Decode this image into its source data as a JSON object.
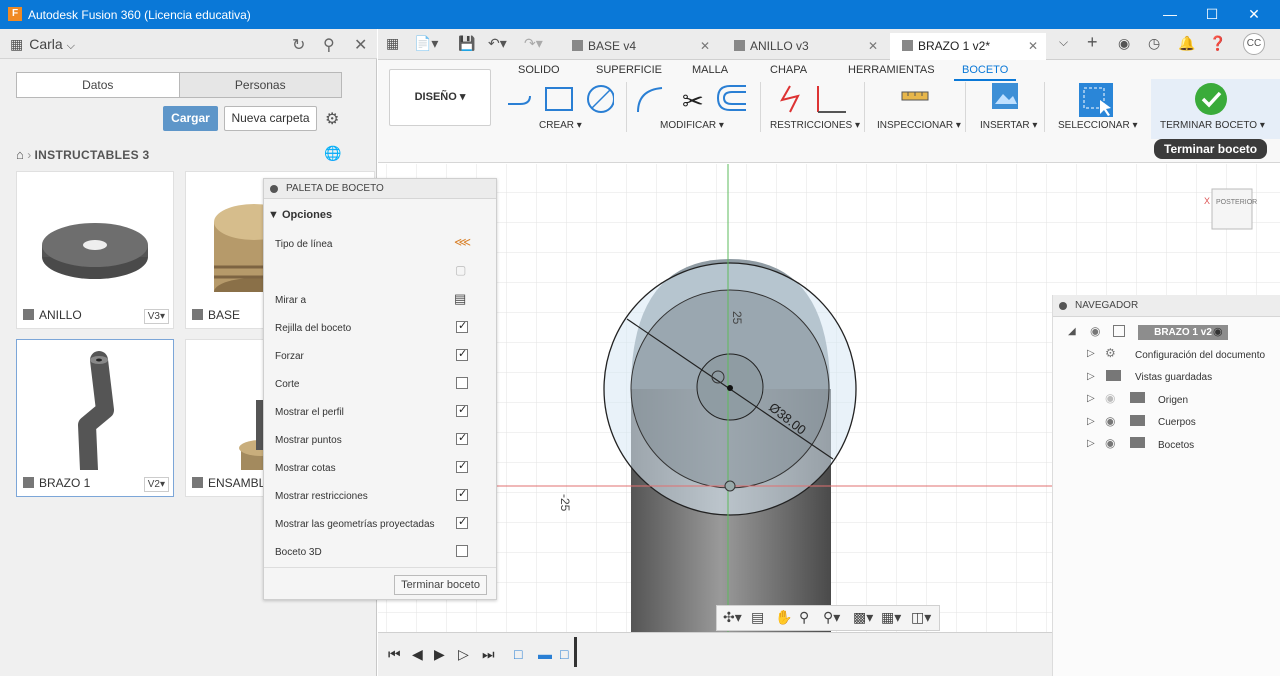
{
  "window": {
    "title": "Autodesk Fusion 360 (Licencia educativa)",
    "logo": "F"
  },
  "left_panel": {
    "user": "Carla",
    "tabs": [
      "Datos",
      "Personas"
    ],
    "upload_label": "Cargar",
    "new_folder_label": "Nueva carpeta",
    "breadcrumb": "INSTRUCTABLES 3",
    "items": [
      {
        "name": "ANILLO",
        "version": "V3"
      },
      {
        "name": "BASE",
        "version": ""
      },
      {
        "name": "BRAZO 1",
        "version": "V2"
      },
      {
        "name": "ENSAMBL",
        "version": ""
      }
    ]
  },
  "doc_tabs": [
    {
      "label": "BASE v4"
    },
    {
      "label": "ANILLO v3"
    },
    {
      "label": "BRAZO 1 v2*"
    }
  ],
  "ribbon": {
    "tabs": [
      "SOLIDO",
      "SUPERFICIE",
      "MALLA",
      "CHAPA",
      "HERRAMIENTAS",
      "BOCETO"
    ],
    "workspace": "DISEÑO",
    "groups": [
      "CREAR",
      "MODIFICAR",
      "RESTRICCIONES",
      "INSPECCIONAR",
      "INSERTAR",
      "SELECCIONAR",
      "TERMINAR BOCETO"
    ],
    "tooltip": "Terminar boceto"
  },
  "palette": {
    "title": "PALETA DE BOCETO",
    "section": "Opciones",
    "rows": [
      {
        "label": "Tipo de línea"
      },
      {
        "label": ""
      },
      {
        "label": "Mirar a"
      },
      {
        "label": "Rejilla del boceto",
        "checked": true
      },
      {
        "label": "Forzar",
        "checked": true
      },
      {
        "label": "Corte",
        "checked": false
      },
      {
        "label": "Mostrar el perfil",
        "checked": true
      },
      {
        "label": "Mostrar puntos",
        "checked": true
      },
      {
        "label": "Mostrar cotas",
        "checked": true
      },
      {
        "label": "Mostrar restricciones",
        "checked": true
      },
      {
        "label": "Mostrar las geometrías proyectadas",
        "checked": true
      },
      {
        "label": "Boceto 3D",
        "checked": false
      }
    ],
    "finish_label": "Terminar boceto"
  },
  "canvas": {
    "dimension_diameter": "Ø38.00",
    "dim_top": "25",
    "dim_side": "-25",
    "viewcube_label": "POSTERIOR"
  },
  "navigator": {
    "title": "NAVEGADOR",
    "root": "BRAZO 1 v2",
    "items": [
      "Configuración del documento",
      "Vistas guardadas",
      "Origen",
      "Cuerpos",
      "Bocetos"
    ]
  }
}
